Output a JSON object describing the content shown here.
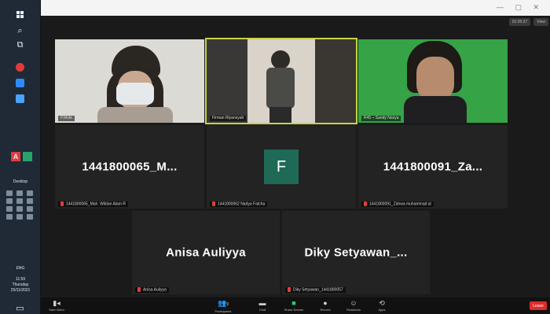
{
  "window": {
    "controls": "— ▢ ✕"
  },
  "taskbar": {
    "start_icon": "windows-icon",
    "desktop_label": "Desktop",
    "lang": "ENG",
    "time": "11:59",
    "day": "Thursday",
    "date": "25/11/2021"
  },
  "meeting": {
    "top_pills": [
      "01:05:37",
      "View"
    ],
    "tiles": [
      {
        "caption": "P.Mutk",
        "muted": false
      },
      {
        "caption": "Firman Riyansyah",
        "muted": false
      },
      {
        "caption": "R45 – Sandy Nasya",
        "muted": false
      },
      {
        "big_name": "1441800065_M...",
        "caption": "1441800065_Muh. Wildan Alam R",
        "muted": true
      },
      {
        "avatar_letter": "F",
        "caption": "1441800062 Nadya Fatcha",
        "muted": true
      },
      {
        "big_name": "1441800091_Za...",
        "caption": "1441800091_Zahwa muhammad al",
        "muted": true
      },
      {
        "big_name": "Anisa Auliyya",
        "caption": "Anisa Auliyya",
        "muted": true
      },
      {
        "big_name": "Diky  Setyawan_...",
        "caption": "Diky Setyawan_1441800057",
        "muted": true
      }
    ]
  },
  "toolbar": {
    "start_video": "Start Video",
    "participants": "Participants",
    "participants_count": "9",
    "chat": "Chat",
    "share_screen": "Share Screen",
    "record": "Record",
    "reactions": "Reactions",
    "apps": "Apps",
    "leave": "Leave"
  },
  "colors": {
    "active_speaker_border": "#c7d34a",
    "share_green": "#2ecc71",
    "leave_red": "#e02b2b",
    "avatar_green": "#1e6a57"
  }
}
